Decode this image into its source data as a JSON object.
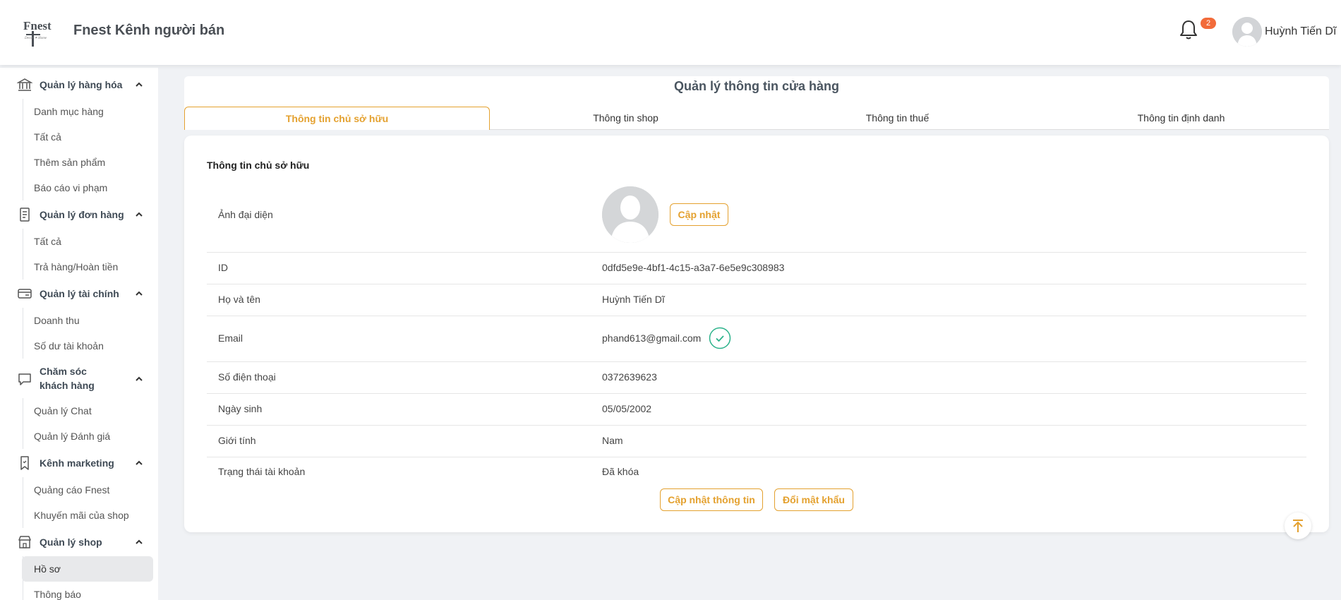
{
  "header": {
    "brand": "Fnest Kênh người bán",
    "logo_text": "Fnest",
    "notification_count": "2",
    "user_name": "Huỳnh Tiến Dĩ"
  },
  "sidebar": {
    "groups": [
      {
        "title": "Quản lý hàng hóa",
        "icon": "bank-icon",
        "items": [
          "Danh mục hàng",
          "Tất cả",
          "Thêm sản phẩm",
          "Báo cáo vi phạm"
        ]
      },
      {
        "title": "Quản lý đơn hàng",
        "icon": "clipboard-icon",
        "items": [
          "Tất cả",
          "Trả hàng/Hoàn tiền"
        ]
      },
      {
        "title": "Quản lý tài chính",
        "icon": "card-icon",
        "items": [
          "Doanh thu",
          "Số dư tài khoản"
        ]
      },
      {
        "title_line1": "Chăm sóc",
        "title_line2": "khách hàng",
        "icon": "chat-icon",
        "items": [
          "Quản lý Chat",
          "Quản lý Đánh giá"
        ]
      },
      {
        "title": "Kênh marketing",
        "icon": "bookmark-icon",
        "items": [
          "Quảng cáo Fnest",
          "Khuyến mãi của shop"
        ]
      },
      {
        "title": "Quản lý shop",
        "icon": "shop-icon",
        "items": [
          "Hồ sơ",
          "Thông báo"
        ]
      }
    ],
    "active_item": "Hồ sơ"
  },
  "main": {
    "title": "Quản lý thông tin cửa hàng",
    "tabs": [
      "Thông tin chủ sở hữu",
      "Thông tin shop",
      "Thông tin thuế",
      "Thông tin định danh"
    ],
    "active_tab": "Thông tin chủ sở hữu",
    "section_title": "Thông tin chủ sở hữu",
    "avatar_label": "Ảnh đại diện",
    "avatar_button": "Cập nhật",
    "fields": [
      {
        "label": "ID",
        "value": "0dfd5e9e-4bf1-4c15-a3a7-6e5e9c308983"
      },
      {
        "label": "Họ và tên",
        "value": "Huỳnh Tiến Dĩ"
      },
      {
        "label": "Email",
        "value": "phand613@gmail.com",
        "verified": true
      },
      {
        "label": "Số điện thoại",
        "value": "0372639623"
      },
      {
        "label": "Ngày sinh",
        "value": "05/05/2002"
      },
      {
        "label": "Giới tính",
        "value": "Nam"
      },
      {
        "label": "Trạng thái tài khoản",
        "value": "Đã khóa"
      }
    ],
    "update_info_button": "Cập nhật thông tin",
    "change_password_button": "Đổi mật khẩu"
  },
  "colors": {
    "accent": "#e4a12f",
    "badge": "#f26b3a",
    "verified": "#2bb28a"
  }
}
